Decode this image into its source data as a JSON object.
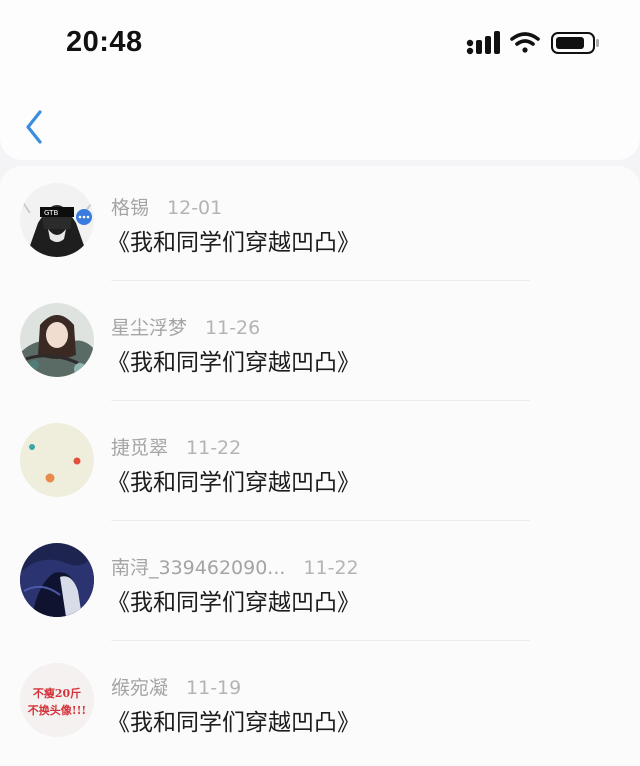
{
  "status_bar": {
    "time": "20:48"
  },
  "nav": {
    "back_icon": "chevron-left-icon",
    "accent_color": "#3b8ddf"
  },
  "items": [
    {
      "name": "格锡",
      "date": "12-01",
      "title": "《我和同学们穿越凹凸》",
      "avatar": "anime-hooded-character-avatar"
    },
    {
      "name": "星尘浮梦",
      "date": "11-26",
      "title": "《我和同学们穿越凹凸》",
      "avatar": "anime-girl-avatar"
    },
    {
      "name": "捷觅翠",
      "date": "11-22",
      "title": "《我和同学们穿越凹凸》",
      "avatar": "beige-dots-avatar"
    },
    {
      "name": "南浔_339462090...",
      "date": "11-22",
      "title": "《我和同学们穿越凹凸》",
      "avatar": "dark-blue-character-avatar"
    },
    {
      "name": "缑宛凝",
      "date": "11-19",
      "title": "《我和同学们穿越凹凸》",
      "avatar": "text-sticker-avatar",
      "avatar_text": [
        "不瘦20斤",
        "不换头像!!!"
      ]
    }
  ]
}
